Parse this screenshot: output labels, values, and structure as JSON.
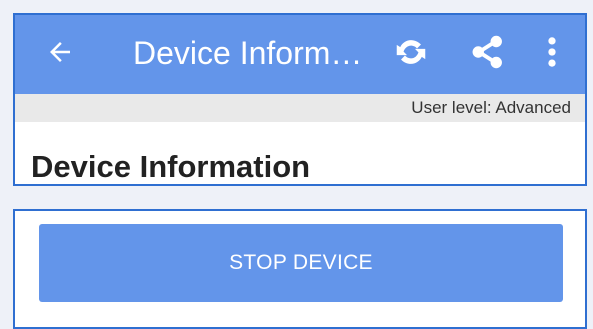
{
  "appbar": {
    "title": "Device Inform…",
    "back_icon": "arrow-back-icon",
    "refresh_icon": "refresh-icon",
    "share_icon": "share-icon",
    "more_icon": "more-vertical-icon",
    "background_color": "#6395ea"
  },
  "user_level": {
    "text": "User level: Advanced"
  },
  "page": {
    "section_title": "Device Information"
  },
  "actions": {
    "stop_device_label": "STOP DEVICE",
    "button_color": "#6395ea"
  },
  "colors": {
    "accent_border": "#2f6fd1",
    "page_background": "#eef1f8",
    "userlevel_background": "#e9e9e9"
  }
}
